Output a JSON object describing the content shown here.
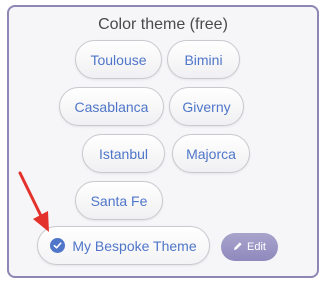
{
  "panel": {
    "title": "Color theme (free)"
  },
  "themes": [
    {
      "id": "toulouse",
      "label": "Toulouse"
    },
    {
      "id": "bimini",
      "label": "Bimini"
    },
    {
      "id": "casablanca",
      "label": "Casablanca"
    },
    {
      "id": "giverny",
      "label": "Giverny"
    },
    {
      "id": "istanbul",
      "label": "Istanbul"
    },
    {
      "id": "majorca",
      "label": "Majorca"
    },
    {
      "id": "santa-fe",
      "label": "Santa Fe"
    }
  ],
  "bespoke": {
    "label": "My Bespoke Theme",
    "selected": true
  },
  "edit": {
    "label": "Edit"
  },
  "colors": {
    "accent": "#4f76c9",
    "frame": "#8e86b4",
    "edit_button": "#9b96c6",
    "annotation_arrow": "#e3322b"
  },
  "icons": {
    "selected": "check-circle-icon",
    "edit": "pencil-icon",
    "annotation": "arrow-annotation"
  }
}
